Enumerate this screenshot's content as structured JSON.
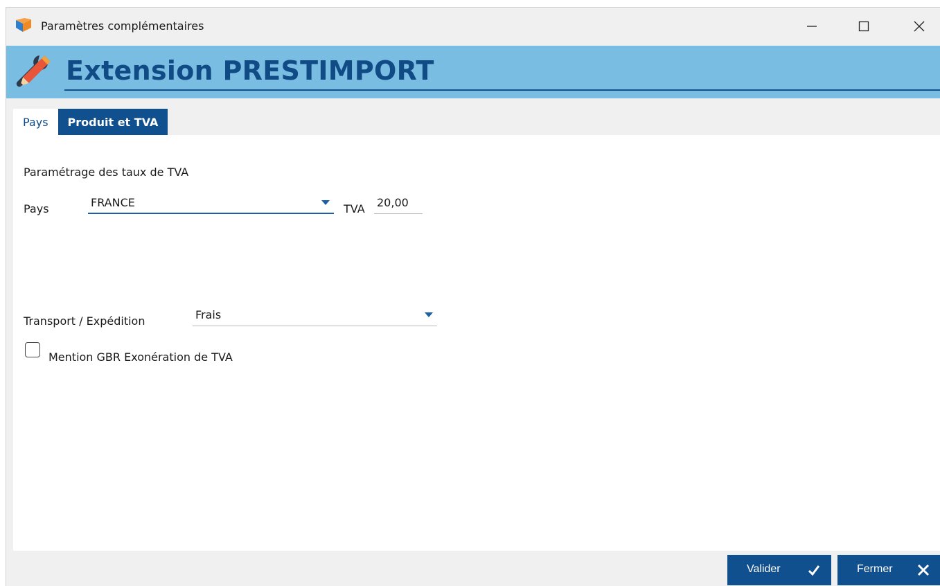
{
  "window": {
    "title": "Paramètres complémentaires"
  },
  "banner": {
    "title": "Extension PRESTIMPORT"
  },
  "tabs": [
    {
      "label": "Pays",
      "active": false
    },
    {
      "label": "Produit et TVA",
      "active": true
    }
  ],
  "form": {
    "section_label": "Paramétrage des taux de TVA",
    "pays_label": "Pays",
    "pays_value": "FRANCE",
    "tva_label": "TVA",
    "tva_value": "20,00",
    "transport_label": "Transport / Expédition",
    "transport_value": "Frais",
    "checkbox_label": "Mention GBR Exonération de TVA",
    "checkbox_checked": false
  },
  "buttons": {
    "valider": "Valider",
    "fermer": "Fermer"
  },
  "colors": {
    "banner": "#79bde3",
    "title_blue": "#114b86",
    "button": "#11508e",
    "accent": "#1b5fa5"
  }
}
